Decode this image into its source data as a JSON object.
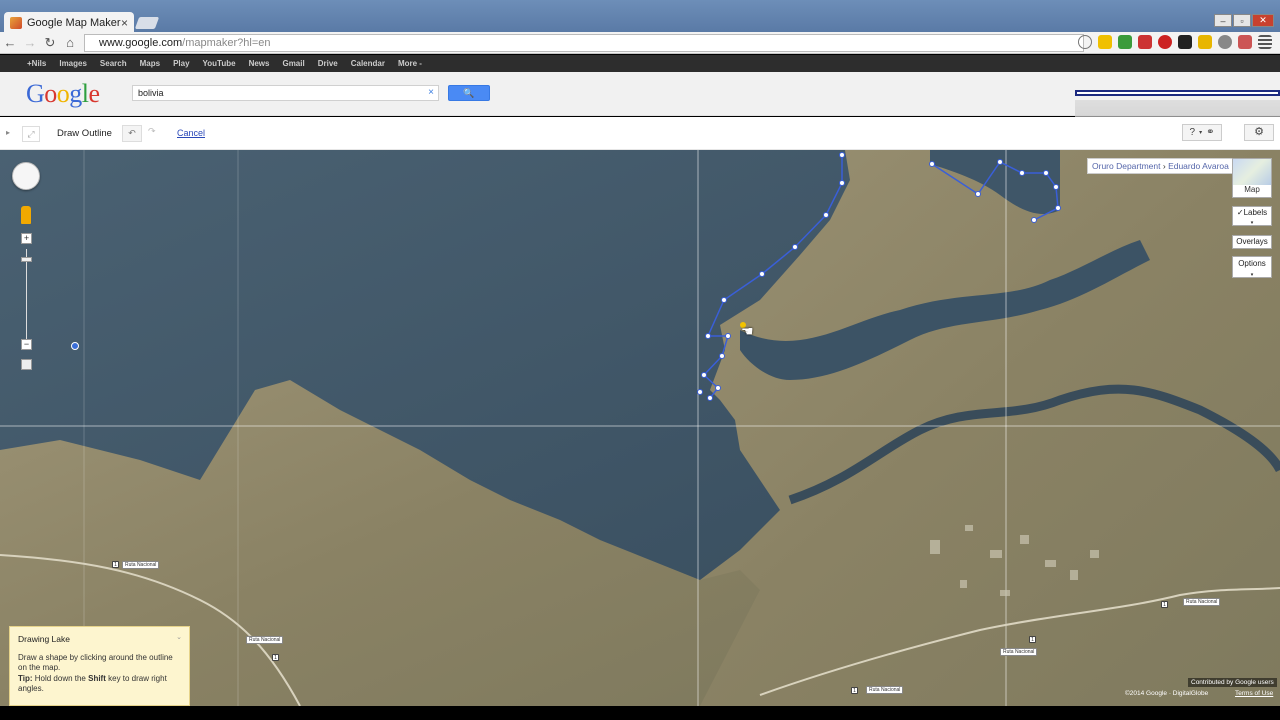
{
  "browser": {
    "tab_title": "Google Map Maker",
    "tab_close": "×",
    "url_host": "www.google.com",
    "url_path": "/mapmaker?hl=en",
    "window_minimize": "–",
    "window_maximize": "▫",
    "window_close": "✕"
  },
  "gbar": {
    "items": [
      "+Nils",
      "Images",
      "Search",
      "Maps",
      "Play",
      "YouTube",
      "News",
      "Gmail",
      "Drive",
      "Calendar",
      "More -"
    ]
  },
  "header": {
    "logo": [
      "G",
      "o",
      "o",
      "g",
      "l",
      "e"
    ],
    "logo_colors": [
      "#3b69d6",
      "#d8372e",
      "#f0b400",
      "#3b69d6",
      "#2e9f3e",
      "#d8372e"
    ],
    "search_value": "bolivia",
    "search_clear": "×",
    "search_button": "🔍"
  },
  "edit_toolbar": {
    "title": "Draw Outline",
    "undo": "↶",
    "redo": "↷",
    "cancel": "Cancel",
    "help": "?",
    "help_caret": "▾",
    "link_icon": "⚭",
    "settings": "⚙"
  },
  "map": {
    "breadcrumb_region": "Oruro Department",
    "breadcrumb_sep": " › ",
    "breadcrumb_place": "Eduardo Avaroa",
    "map_type_label": "Map",
    "labels_button": "✓Labels",
    "overlays_button": "Overlays",
    "options_button": "Options",
    "zoom_in": "+",
    "zoom_out": "−",
    "road_shield": "1",
    "road_label": "Ruta Nacional"
  },
  "hint": {
    "title": "Drawing Lake",
    "line1": "Draw a shape by clicking around the outline on the map.",
    "tip_label": "Tip:",
    "tip_text_pre": " Hold down the ",
    "tip_key": "Shift",
    "tip_text_post": " key to draw right angles."
  },
  "footer": {
    "contributed": "Contributed by Google users",
    "copyright": "©2014 Google · DigitalGlobe",
    "terms": "Terms of Use"
  },
  "colors": {
    "gbar_bg": "#2d2d2d",
    "lake": "#3f5668",
    "land": "#8d8567",
    "outline_points": "#ffffff",
    "outline_line": "#3a5fd8"
  }
}
